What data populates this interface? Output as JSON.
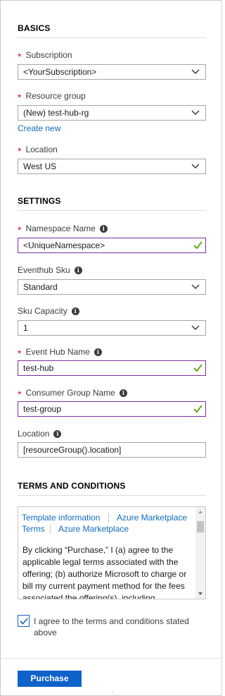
{
  "basics": {
    "title": "BASICS",
    "subscription": {
      "label": "Subscription",
      "value": "<YourSubscription>"
    },
    "resource_group": {
      "label": "Resource group",
      "value": "(New) test-hub-rg",
      "create_new": "Create new"
    },
    "location": {
      "label": "Location",
      "value": "West US"
    }
  },
  "settings": {
    "title": "SETTINGS",
    "namespace_name": {
      "label": "Namespace Name",
      "value": "<UniqueNamespace>"
    },
    "eventhub_sku": {
      "label": "Eventhub Sku",
      "value": "Standard"
    },
    "sku_capacity": {
      "label": "Sku Capacity",
      "value": "1"
    },
    "event_hub_name": {
      "label": "Event Hub Name",
      "value": "test-hub"
    },
    "consumer_group_name": {
      "label": "Consumer Group Name",
      "value": "test-group"
    },
    "location": {
      "label": "Location",
      "value": "[resourceGroup().location]"
    }
  },
  "terms": {
    "title": "TERMS AND CONDITIONS",
    "link_template": "Template information",
    "link_marketplace_1": "Azure Marketplace",
    "link_terms": "Terms",
    "link_marketplace_2": "Azure Marketplace",
    "body": "By clicking “Purchase,” I (a) agree to the applicable legal terms associated with the offering; (b) authorize Microsoft to charge or bill my current payment method for the fees associated the offering(s), including",
    "agree_label": "I agree to the terms and conditions stated above",
    "agree_checked": true
  },
  "footer": {
    "purchase_label": "Purchase"
  },
  "colors": {
    "required": "#e00b1c",
    "link": "#0f6cbd",
    "valid_border": "#7a2f9c",
    "valid_check": "#57a300",
    "button": "#0f62c9"
  },
  "icons": {
    "info": "info-icon",
    "dropdown": "chevron-down-icon",
    "valid": "checkmark-icon"
  }
}
